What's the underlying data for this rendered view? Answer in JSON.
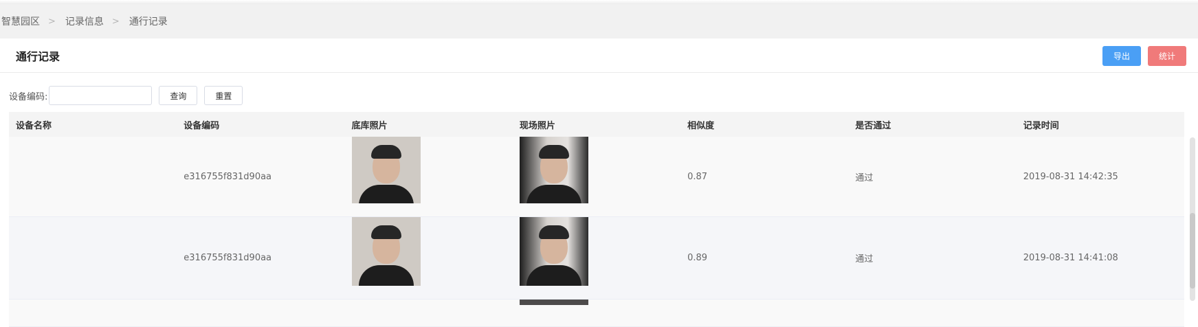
{
  "breadcrumb": [
    "智慧园区",
    "记录信息",
    "通行记录"
  ],
  "breadcrumb_separator": ">",
  "page": {
    "title": "通行记录"
  },
  "toolbar": {
    "export_label": "导出",
    "stats_label": "统计",
    "export_color": "#4a9ff5",
    "stats_color": "#f07a7a"
  },
  "filter": {
    "device_code_label": "设备编码:",
    "device_code_value": "",
    "query_label": "查询",
    "reset_label": "重置"
  },
  "table": {
    "columns": [
      "设备名称",
      "设备编码",
      "底库照片",
      "现场照片",
      "相似度",
      "是否通过",
      "记录时间"
    ],
    "rows": [
      {
        "device_name": "",
        "device_code": "e316755f831d90aa",
        "base_photo": "face-photo",
        "scene_photo": "face-photo",
        "similarity": "0.87",
        "passed": "通过",
        "record_time": "2019-08-31 14:42:35"
      },
      {
        "device_name": "",
        "device_code": "e316755f831d90aa",
        "base_photo": "face-photo",
        "scene_photo": "face-photo",
        "similarity": "0.89",
        "passed": "通过",
        "record_time": "2019-08-31 14:41:08"
      }
    ]
  }
}
